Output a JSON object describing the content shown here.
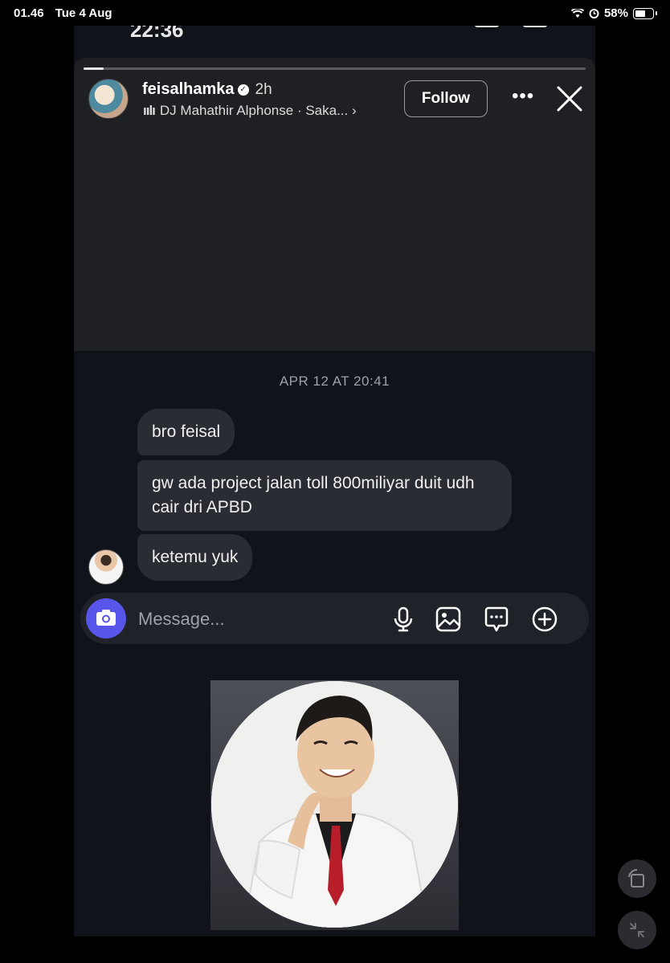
{
  "status_bar": {
    "time": "01.46",
    "date": "Tue 4 Aug",
    "battery": "58%"
  },
  "story": {
    "username": "feisalhamka",
    "time_ago": "2h",
    "music": "DJ Mahathir Alphonse · Saka...",
    "follow_label": "Follow",
    "progress": 0.04
  },
  "chat": {
    "timestamp": "APR 12 AT 20:41",
    "messages": [
      "bro feisal",
      "gw ada project jalan toll 800miliyar duit udh cair dri APBD",
      "ketemu yuk"
    ]
  },
  "composer": {
    "placeholder": "Message..."
  },
  "icons": {
    "camera": "camera-icon",
    "mic": "microphone-icon",
    "gallery": "image-icon",
    "sticker": "chat-bubble-icon",
    "add": "plus-circle-icon",
    "close": "close-icon",
    "more": "more-icon"
  },
  "colors": {
    "accent": "#5856ea",
    "bubble": "#2a2c34",
    "background": "#11131a"
  }
}
